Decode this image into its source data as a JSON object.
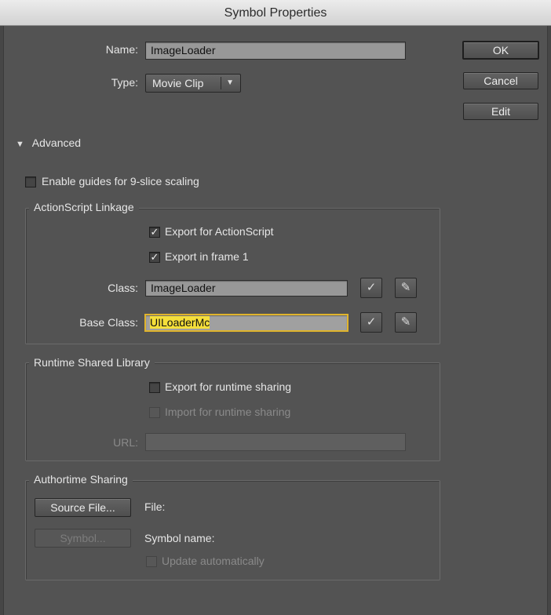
{
  "window": {
    "title": "Symbol Properties"
  },
  "buttons": {
    "ok": "OK",
    "cancel": "Cancel",
    "edit": "Edit"
  },
  "general": {
    "name_label": "Name:",
    "name_value": "ImageLoader",
    "type_label": "Type:",
    "type_value": "Movie Clip"
  },
  "advanced": {
    "label": "Advanced",
    "expanded": true,
    "nine_slice_label": "Enable guides for 9-slice scaling",
    "nine_slice_checked": false
  },
  "linkage": {
    "legend": "ActionScript Linkage",
    "export_as_label": "Export for ActionScript",
    "export_as_checked": true,
    "export_frame1_label": "Export in frame 1",
    "export_frame1_checked": true,
    "class_label": "Class:",
    "class_value": "ImageLoader",
    "base_class_label": "Base Class:",
    "base_class_value": "UILoaderMc"
  },
  "runtime": {
    "legend": "Runtime Shared Library",
    "export_label": "Export for runtime sharing",
    "export_checked": false,
    "import_label": "Import for runtime sharing",
    "import_checked": false,
    "url_label": "URL:",
    "url_value": ""
  },
  "authortime": {
    "legend": "Authortime Sharing",
    "source_button": "Source File...",
    "file_label": "File:",
    "symbol_button": "Symbol...",
    "symbol_name_label": "Symbol name:",
    "update_label": "Update automatically",
    "update_checked": false
  },
  "icons": {
    "checkmark": "✓",
    "pencil": "✎",
    "dropdown": "▼",
    "disclosure": "▼"
  },
  "colors": {
    "focus_ring": "#e0b42c",
    "selection": "#f5df3a",
    "dialog_bg": "#535353"
  }
}
